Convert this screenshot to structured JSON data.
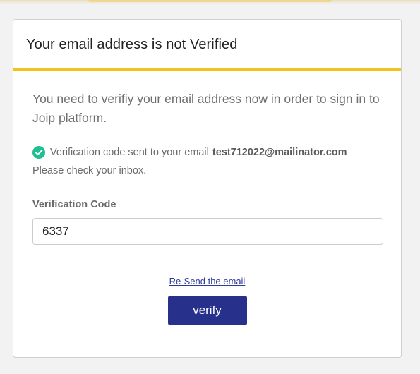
{
  "card": {
    "title": "Your email address is not Verified",
    "intro": "You need to verifiy your email address now in order to sign in to Joip platform.",
    "notice": {
      "sent_text": "Verification code sent to your email",
      "email": "test712022@mailinator.com",
      "check_inbox": "Please check your inbox."
    },
    "field": {
      "label": "Verification Code",
      "value": "6337",
      "placeholder": ""
    },
    "resend_link": "Re-Send the email",
    "verify_button": "verify"
  },
  "colors": {
    "accent_yellow": "#f2c31d",
    "button_blue": "#27318b",
    "check_green": "#1fbf8f"
  },
  "icons": {
    "notice_icon": "check-circle-icon"
  }
}
